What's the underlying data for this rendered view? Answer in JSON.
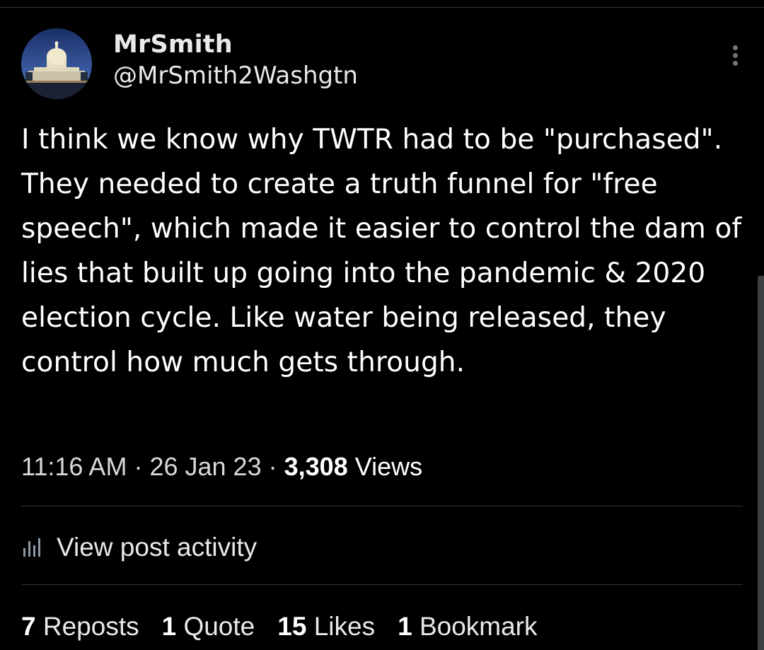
{
  "tweet": {
    "display_name": "MrSmith",
    "handle": "@MrSmith2Washgtn",
    "avatar_icon": "capitol-building-avatar",
    "text": "I think we know why TWTR had to be \"purchased\".  They needed to create a truth funnel for \"free speech\", which made it easier to control the dam of lies that built up going into the pandemic & 2020 election cycle. Like water being released, they control how much gets through.",
    "time": "11:16 AM",
    "separator": "·",
    "date": "26 Jan 23",
    "views_count": "3,308",
    "views_label": "Views"
  },
  "activity": {
    "icon": "bar-chart-icon",
    "label": "View post activity"
  },
  "stats": {
    "reposts_count": "7",
    "reposts_label": "Reposts",
    "quote_count": "1",
    "quote_label": "Quote",
    "likes_count": "15",
    "likes_label": "Likes",
    "bookmark_count": "1",
    "bookmark_label": "Bookmark"
  },
  "colors": {
    "background": "#000000",
    "text_primary": "#e7e9ea",
    "text_secondary": "#71767b",
    "divider": "#2f3336"
  }
}
